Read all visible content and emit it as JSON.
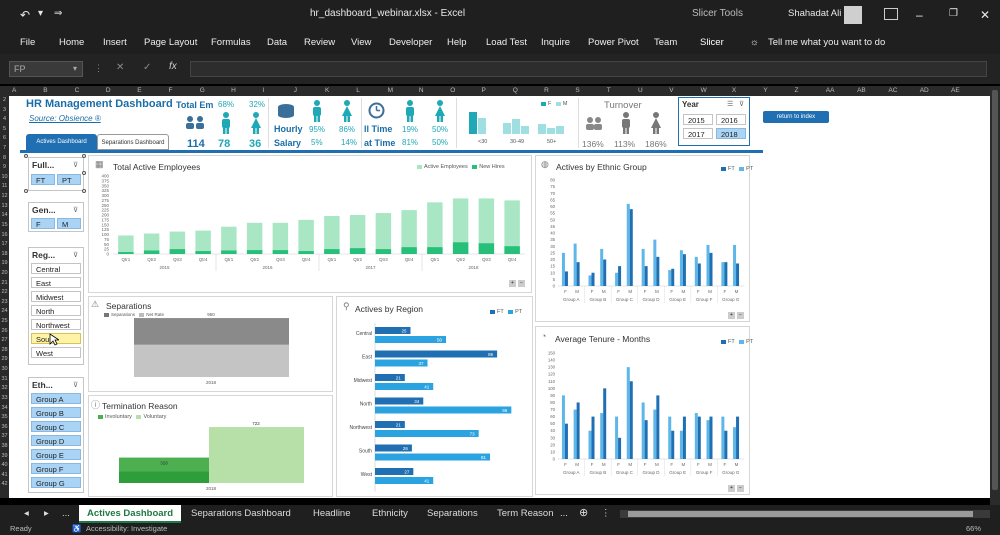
{
  "window": {
    "title": "hr_dashboard_webinar.xlsx  -  Excel",
    "context_tab": "Slicer Tools",
    "user": "Shahadat Ali"
  },
  "ribbon": {
    "tabs": [
      "File",
      "Home",
      "Insert",
      "Page Layout",
      "Formulas",
      "Data",
      "Review",
      "View",
      "Developer",
      "Help",
      "Load Test",
      "Inquire",
      "Power Pivot",
      "Team",
      "Slicer"
    ],
    "tell_me": "Tell me what you want to do"
  },
  "formula_bar": {
    "name_box": "FP",
    "formula": ""
  },
  "columns": [
    "A",
    "B",
    "C",
    "D",
    "E",
    "F",
    "G",
    "H",
    "I",
    "J",
    "K",
    "L",
    "M",
    "N",
    "O",
    "P",
    "Q",
    "R",
    "S",
    "T",
    "U",
    "V",
    "W",
    "X",
    "Y",
    "Z",
    "AA",
    "AB",
    "AC",
    "AD",
    "AE"
  ],
  "rows": [
    "2",
    "3",
    "4",
    "5",
    "6",
    "7",
    "8",
    "9",
    "10",
    "11",
    "12",
    "13",
    "14",
    "15",
    "16",
    "17",
    "18",
    "19",
    "20",
    "21",
    "22",
    "23",
    "24",
    "25",
    "26",
    "27",
    "28",
    "29",
    "30",
    "31",
    "32",
    "33",
    "34",
    "35",
    "36",
    "37",
    "38",
    "39",
    "40",
    "41",
    "42"
  ],
  "header": {
    "title": "HR Management Dashboard",
    "source": "Source: Obsience ®",
    "tab_active": "Actives Dashboard",
    "tab_other": "Separations Dashboard"
  },
  "kpis": {
    "total_label": "Total Em",
    "total_value": "114",
    "male_pct": "68%",
    "male_value": "78",
    "female_pct": "32%",
    "female_value": "36",
    "hourly_label": "Hourly",
    "salary_label": "Salary",
    "hourly_male": "95%",
    "hourly_female": "86%",
    "salary_male": "5%",
    "salary_female": "14%",
    "full_time_label": "ll Time",
    "part_time_label": "at Time",
    "ft_male": "19%",
    "ft_female": "50%",
    "pt_male": "81%",
    "pt_female": "50%",
    "turnover_label": "Turnover",
    "turnover_total": "136%",
    "turnover_male": "113%",
    "turnover_female": "186%",
    "age_legend": [
      "F",
      "M"
    ],
    "age_labels": [
      "<30",
      "30-49",
      "50+"
    ]
  },
  "year_slicer": {
    "title": "Year",
    "items": [
      "2015",
      "2016",
      "2017",
      "2018"
    ],
    "selected": "2018"
  },
  "return_button": "return to index",
  "slicers": {
    "fulltime": {
      "title": "Full...",
      "items": [
        "FT",
        "PT"
      ]
    },
    "gender": {
      "title": "Gen...",
      "items": [
        "F",
        "M"
      ]
    },
    "region": {
      "title": "Reg...",
      "items": [
        "Central",
        "East",
        "Midwest",
        "North",
        "Northwest",
        "Sout",
        "West"
      ]
    },
    "ethnic": {
      "title": "Eth...",
      "items": [
        "Group A",
        "Group B",
        "Group C",
        "Group D",
        "Group E",
        "Group F",
        "Group G"
      ]
    }
  },
  "charts": {
    "total_active": {
      "title": "Total Active Employees",
      "legend": [
        "Active Employees",
        "New Hires"
      ]
    },
    "separations": {
      "title": "Separations",
      "legend": [
        "Separations",
        "Net Rate"
      ],
      "year": "2018"
    },
    "termination": {
      "title": "Termination Reason",
      "legend": [
        "Involuntary",
        "Voluntary"
      ],
      "year": "2018"
    },
    "region": {
      "title": "Actives by Region",
      "legend": [
        "FT",
        "PT"
      ]
    },
    "ethnic": {
      "title": "Actives by Ethnic Group",
      "legend": [
        "FT",
        "PT"
      ]
    },
    "tenure": {
      "title": "Average Tenure - Months",
      "legend": [
        "FT",
        "PT"
      ]
    }
  },
  "chart_data": [
    {
      "type": "bar",
      "title": "Total Active Employees",
      "categories": [
        "Qtr1",
        "Qtr2",
        "Qtr3",
        "Qtr4",
        "Qtr1",
        "Qtr2",
        "Qtr3",
        "Qtr4",
        "Qtr1",
        "Qtr2",
        "Qtr3",
        "Qtr4",
        "Qtr1",
        "Qtr2",
        "Qtr3",
        "Qtr4"
      ],
      "years": [
        "2015",
        "2016",
        "2017",
        "2018"
      ],
      "ylim": [
        0,
        400
      ],
      "yticks": [
        0,
        25,
        50,
        75,
        100,
        125,
        150,
        175,
        200,
        225,
        250,
        275,
        300,
        325,
        350,
        375,
        400
      ],
      "series": [
        {
          "name": "Active Employees",
          "values": [
            95,
            105,
            115,
            120,
            140,
            160,
            160,
            175,
            195,
            200,
            210,
            225,
            265,
            285,
            285,
            275
          ]
        },
        {
          "name": "New Hires",
          "values": [
            10,
            18,
            25,
            15,
            18,
            20,
            20,
            15,
            25,
            30,
            25,
            35,
            35,
            60,
            55,
            40
          ]
        }
      ],
      "legend": "top-right"
    },
    {
      "type": "bar",
      "title": "Actives by Region",
      "categories": [
        "Central",
        "East",
        "Midwest",
        "North",
        "Northwest",
        "South",
        "West"
      ],
      "xlim": [
        0,
        100
      ],
      "series": [
        {
          "name": "FT",
          "values": [
            25,
            86,
            21,
            34,
            21,
            26,
            27
          ]
        },
        {
          "name": "PT",
          "values": [
            50,
            37,
            41,
            96,
            73,
            81,
            41
          ]
        }
      ],
      "legend": "top-right"
    },
    {
      "type": "bar",
      "title": "Actives by Ethnic Group",
      "categories": [
        "Group A",
        "Group B",
        "Group C",
        "Group D",
        "Group E",
        "Group F",
        "Group G"
      ],
      "sub_categories": [
        "F",
        "M"
      ],
      "ylim": [
        0,
        80
      ],
      "yticks": [
        0,
        5,
        10,
        15,
        20,
        25,
        30,
        35,
        40,
        45,
        50,
        55,
        60,
        65,
        70,
        75,
        80
      ],
      "series": [
        {
          "name": "FT",
          "values": [
            [
              11,
              18
            ],
            [
              10,
              20
            ],
            [
              15,
              58
            ],
            [
              15,
              22
            ],
            [
              13,
              24
            ],
            [
              17,
              25
            ],
            [
              18,
              17
            ]
          ]
        },
        {
          "name": "PT",
          "values": [
            [
              25,
              32
            ],
            [
              8,
              28
            ],
            [
              10,
              62
            ],
            [
              28,
              35
            ],
            [
              12,
              27
            ],
            [
              22,
              31
            ],
            [
              18,
              31
            ]
          ]
        }
      ],
      "legend": "top-right"
    },
    {
      "type": "bar",
      "title": "Average Tenure - Months",
      "categories": [
        "Group A",
        "Group B",
        "Group C",
        "Group D",
        "Group E",
        "Group F",
        "Group G"
      ],
      "sub_categories": [
        "F",
        "M"
      ],
      "ylim": [
        0,
        150
      ],
      "yticks": [
        0,
        10,
        20,
        30,
        40,
        50,
        60,
        70,
        80,
        90,
        100,
        110,
        120,
        130,
        140,
        150
      ],
      "series": [
        {
          "name": "FT",
          "values": [
            [
              50,
              80
            ],
            [
              60,
              100
            ],
            [
              30,
              110
            ],
            [
              55,
              90
            ],
            [
              40,
              60
            ],
            [
              60,
              60
            ],
            [
              40,
              60
            ]
          ]
        },
        {
          "name": "PT",
          "values": [
            [
              90,
              70
            ],
            [
              40,
              65
            ],
            [
              60,
              130
            ],
            [
              80,
              70
            ],
            [
              60,
              40
            ],
            [
              65,
              55
            ],
            [
              60,
              45
            ]
          ]
        }
      ],
      "legend": "top-right"
    },
    {
      "type": "bar",
      "title": "Termination Reason",
      "categories": [
        "2018"
      ],
      "series": [
        {
          "name": "Involuntary",
          "values": [
            328
          ]
        },
        {
          "name": "Voluntary",
          "values": [
            722
          ]
        }
      ]
    },
    {
      "type": "bar",
      "title": "Separations",
      "categories": [
        "2018"
      ],
      "series": [
        {
          "name": "Separations",
          "values": [
            950
          ]
        },
        {
          "name": "Net Rate",
          "values": [
            0
          ]
        }
      ]
    }
  ],
  "sheet_tabs": [
    "Actives Dashboard",
    "Separations Dashboard",
    "Headline",
    "Ethnicity",
    "Separations",
    "Term Reason"
  ],
  "sheet_tab_more": "...",
  "status": {
    "ready": "Ready",
    "accessibility": "Accessibility: Investigate",
    "zoom": "66%"
  }
}
